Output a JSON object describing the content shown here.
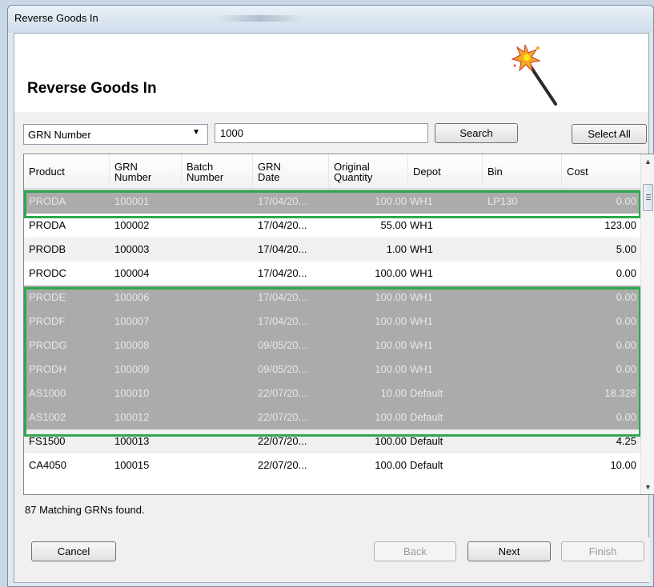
{
  "window": {
    "title": "Reverse Goods In"
  },
  "header": {
    "title": "Reverse Goods In",
    "icon": "magic-wand-icon"
  },
  "search": {
    "field_selected": "GRN Number",
    "value": "1000",
    "search_label": "Search",
    "select_all_label": "Select All"
  },
  "grid": {
    "columns": [
      [
        "Product"
      ],
      [
        "GRN",
        "Number"
      ],
      [
        "Batch",
        "Number"
      ],
      [
        "GRN",
        "Date"
      ],
      [
        "Original",
        "Quantity"
      ],
      [
        "Depot"
      ],
      [
        "Bin"
      ],
      [
        "Cost"
      ]
    ],
    "rows": [
      {
        "product": "PRODA",
        "grn": "100001",
        "batch": "",
        "date": "17/04/20...",
        "qty": "100.00",
        "depot": "WH1",
        "bin": "LP130",
        "cost": "0.00",
        "selected": true
      },
      {
        "product": "PRODA",
        "grn": "100002",
        "batch": "",
        "date": "17/04/20...",
        "qty": "55.00",
        "depot": "WH1",
        "bin": "",
        "cost": "123.00",
        "selected": false
      },
      {
        "product": "PRODB",
        "grn": "100003",
        "batch": "",
        "date": "17/04/20...",
        "qty": "1.00",
        "depot": "WH1",
        "bin": "",
        "cost": "5.00",
        "selected": false
      },
      {
        "product": "PRODC",
        "grn": "100004",
        "batch": "",
        "date": "17/04/20...",
        "qty": "100.00",
        "depot": "WH1",
        "bin": "",
        "cost": "0.00",
        "selected": false
      },
      {
        "product": "PRODE",
        "grn": "100006",
        "batch": "",
        "date": "17/04/20...",
        "qty": "100.00",
        "depot": "WH1",
        "bin": "",
        "cost": "0.00",
        "selected": true
      },
      {
        "product": "PRODF",
        "grn": "100007",
        "batch": "",
        "date": "17/04/20...",
        "qty": "100.00",
        "depot": "WH1",
        "bin": "",
        "cost": "0.00",
        "selected": true
      },
      {
        "product": "PRODG",
        "grn": "100008",
        "batch": "",
        "date": "09/05/20...",
        "qty": "100.00",
        "depot": "WH1",
        "bin": "",
        "cost": "0.00",
        "selected": true
      },
      {
        "product": "PRODH",
        "grn": "100009",
        "batch": "",
        "date": "09/05/20...",
        "qty": "100.00",
        "depot": "WH1",
        "bin": "",
        "cost": "0.00",
        "selected": true
      },
      {
        "product": "AS1000",
        "grn": "100010",
        "batch": "",
        "date": "22/07/20...",
        "qty": "10.00",
        "depot": "Default",
        "bin": "",
        "cost": "18.328",
        "selected": true
      },
      {
        "product": "AS1002",
        "grn": "100012",
        "batch": "",
        "date": "22/07/20...",
        "qty": "100.00",
        "depot": "Default",
        "bin": "",
        "cost": "0.00",
        "selected": true
      },
      {
        "product": "FS1500",
        "grn": "100013",
        "batch": "",
        "date": "22/07/20...",
        "qty": "100.00",
        "depot": "Default",
        "bin": "",
        "cost": "4.25",
        "selected": false
      },
      {
        "product": "CA4050",
        "grn": "100015",
        "batch": "",
        "date": "22/07/20...",
        "qty": "100.00",
        "depot": "Default",
        "bin": "",
        "cost": "10.00",
        "selected": false
      }
    ],
    "highlight_color": "#2ea84e",
    "selected_row_color": "#ababab"
  },
  "status": {
    "text": "87 Matching GRNs found."
  },
  "footer": {
    "cancel_label": "Cancel",
    "back_label": "Back",
    "next_label": "Next",
    "finish_label": "Finish"
  }
}
